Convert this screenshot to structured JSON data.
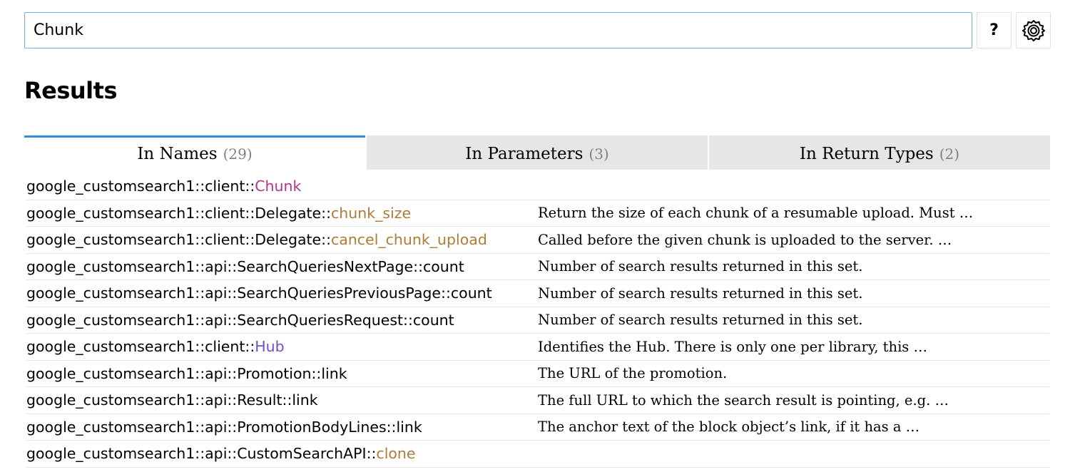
{
  "search": {
    "value": "Chunk",
    "help_label": "?",
    "settings_icon": "gear-icon"
  },
  "results_heading": "Results",
  "tabs": [
    {
      "label": "In Names",
      "count": "(29)",
      "active": true
    },
    {
      "label": "In Parameters",
      "count": "(3)",
      "active": false
    },
    {
      "label": "In Return Types",
      "count": "(2)",
      "active": false
    }
  ],
  "colors": {
    "struct": "#ad378a",
    "method": "#ad7c37",
    "trait": "#6e4fc9",
    "active_tab_border": "#2c8fe0"
  },
  "results": [
    {
      "path": "google_customsearch1::client::",
      "name": "Chunk",
      "kind": "struct",
      "desc": ""
    },
    {
      "path": "google_customsearch1::client::Delegate::",
      "name": "chunk_size",
      "kind": "method",
      "desc": "Return the size of each chunk of a resumable upload. Must …"
    },
    {
      "path": "google_customsearch1::client::Delegate::",
      "name": "cancel_chunk_upload",
      "kind": "method",
      "desc": "Called before the given chunk is uploaded to the server. …"
    },
    {
      "path": "google_customsearch1::api::SearchQueriesNextPage::",
      "name": "count",
      "kind": "field",
      "desc": "Number of search results returned in this set."
    },
    {
      "path": "google_customsearch1::api::SearchQueriesPreviousPage::",
      "name": "count",
      "kind": "field",
      "desc": "Number of search results returned in this set."
    },
    {
      "path": "google_customsearch1::api::SearchQueriesRequest::",
      "name": "count",
      "kind": "field",
      "desc": "Number of search results returned in this set."
    },
    {
      "path": "google_customsearch1::client::",
      "name": "Hub",
      "kind": "trait",
      "desc": "Identifies the Hub. There is only one per library, this …"
    },
    {
      "path": "google_customsearch1::api::Promotion::",
      "name": "link",
      "kind": "field",
      "desc": "The URL of the promotion."
    },
    {
      "path": "google_customsearch1::api::Result::",
      "name": "link",
      "kind": "field",
      "desc": "The full URL to which the search result is pointing, e.g. …"
    },
    {
      "path": "google_customsearch1::api::PromotionBodyLines::",
      "name": "link",
      "kind": "field",
      "desc": "The anchor text of the block object’s link, if it has a …"
    },
    {
      "path": "google_customsearch1::api::CustomSearchAPI::",
      "name": "clone",
      "kind": "method",
      "desc": ""
    }
  ]
}
